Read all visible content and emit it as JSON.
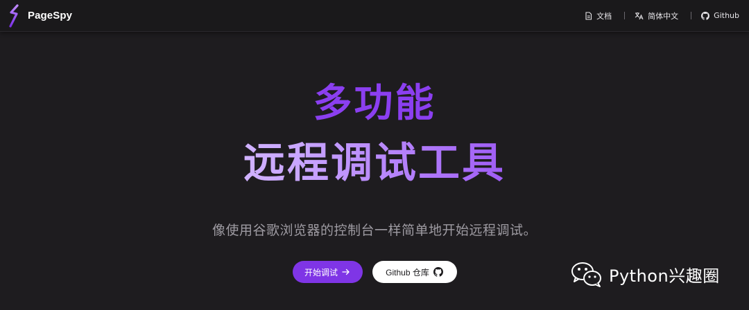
{
  "app": {
    "name": "PageSpy"
  },
  "nav": {
    "docs_label": "文档",
    "language_label": "简体中文",
    "github_label": "Github"
  },
  "hero": {
    "title_line1": "多功能",
    "title_line2": "远程调试工具",
    "subtitle": "像使用谷歌浏览器的控制台一样简单地开始远程调试。",
    "primary_button": "开始调试",
    "secondary_button": "Github 仓库"
  },
  "watermark": {
    "text": "Python兴趣圈"
  },
  "colors": {
    "background": "#1e1c1f",
    "navbar": "#1a191b",
    "accent": "#7f35e6",
    "title_purple": "#8b3ff0",
    "subtitle": "#9e9ba2"
  },
  "icons": {
    "logo": "pagespy-logo-icon",
    "docs": "document-icon",
    "language": "translate-icon",
    "github": "github-icon",
    "arrow": "arrow-right-icon",
    "wechat": "wechat-icon"
  }
}
